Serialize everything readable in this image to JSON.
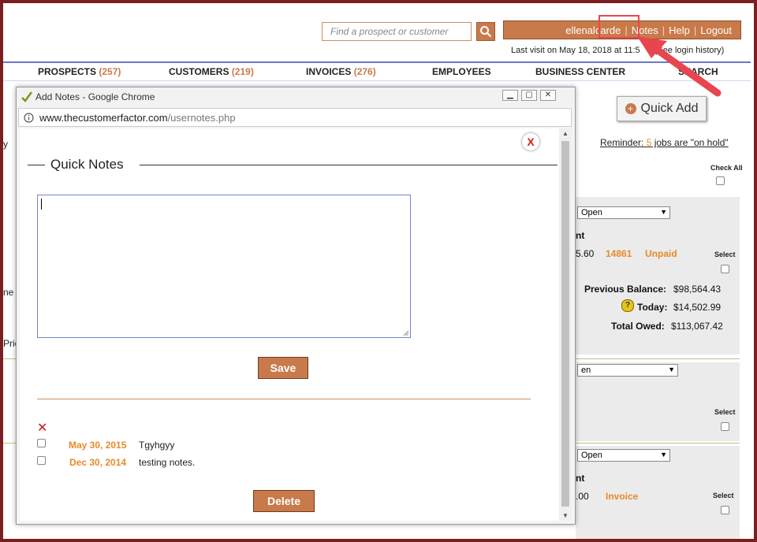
{
  "search": {
    "placeholder": "Find a prospect or customer"
  },
  "userbar": {
    "username": "ellenalcarde",
    "notes": "Notes",
    "help": "Help",
    "logout": "Logout"
  },
  "last_visit": {
    "text": "Last visit on May 18, 2018 at 11:5",
    "history_link": "(See login history)"
  },
  "nav": [
    {
      "label": "PROSPECTS",
      "count": "(257)"
    },
    {
      "label": "CUSTOMERS",
      "count": "(219)"
    },
    {
      "label": "INVOICES",
      "count": "(276)"
    },
    {
      "label": "EMPLOYEES",
      "count": ""
    },
    {
      "label": "BUSINESS CENTER",
      "count": ""
    },
    {
      "label": "SEARCH",
      "count": ""
    }
  ],
  "quick_add": "Quick Add",
  "reminder": {
    "prefix": "Reminder: ",
    "count": "5",
    "suffix": " jobs are \"on hold\""
  },
  "check_all": "Check All",
  "panels": [
    {
      "status": "Open",
      "amount_tail": "5.60",
      "invoice_no": "14861",
      "invoice_status": "Unpaid",
      "select": "Select",
      "prev_balance_label": "Previous Balance:",
      "prev_balance": "$98,564.43",
      "today_label": "Today:",
      "today": "$14,502.99",
      "total_label": "Total Owed:",
      "total": "$113,067.42",
      "header_tail": "nt"
    },
    {
      "status": "en",
      "select": "Select"
    },
    {
      "status": "Open",
      "amount_tail": ".00",
      "invoice_status": "Invoice",
      "select": "Select",
      "header_tail": "nt"
    }
  ],
  "left_fragments": [
    "y",
    "ne",
    "Pric"
  ],
  "popup": {
    "window_title": "Add Notes - Google Chrome",
    "url_host": "www.thecustomerfactor.com",
    "url_path": "/usernotes.php",
    "heading": "Quick Notes",
    "save_label": "Save",
    "delete_label": "Delete",
    "notes": [
      {
        "date": "May 30, 2015",
        "text": "Tgyhgyy"
      },
      {
        "date": "Dec 30, 2014",
        "text": "testing notes."
      }
    ]
  },
  "colors": {
    "accent": "#c97a4a",
    "orange_text": "#e88a2a",
    "frame": "#7a1f1f",
    "highlight": "#e8454f"
  }
}
